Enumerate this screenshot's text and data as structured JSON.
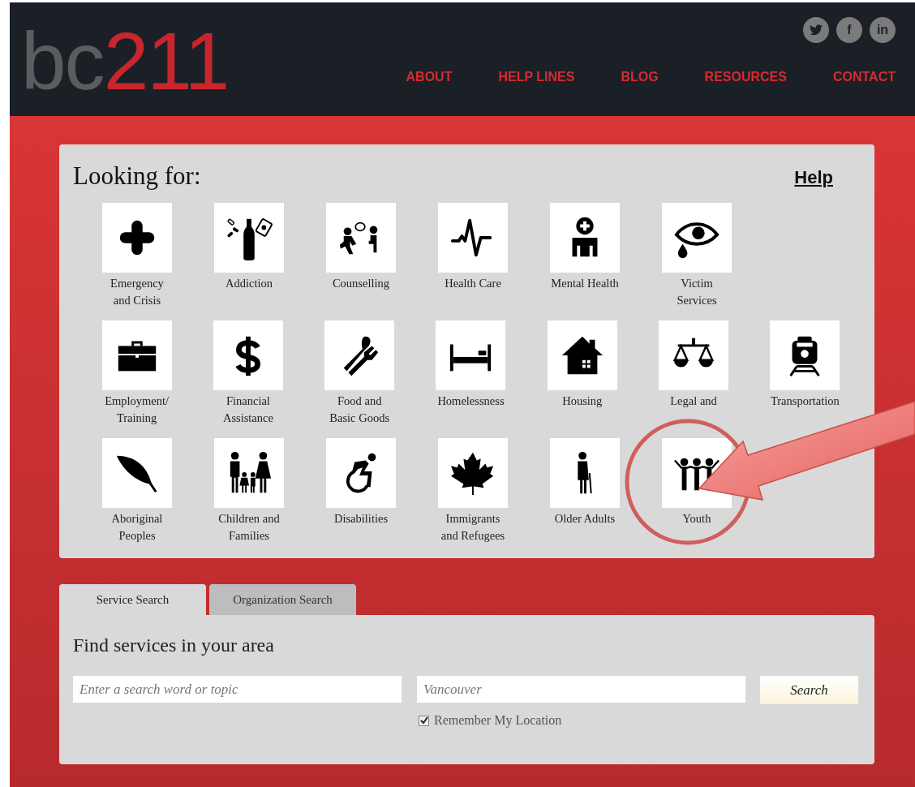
{
  "header": {
    "logo": {
      "prefix": "bc",
      "number": "211"
    },
    "social": [
      {
        "kind": "twitter"
      },
      {
        "kind": "text",
        "text": "f"
      },
      {
        "kind": "text",
        "text": "in"
      }
    ],
    "nav": [
      "ABOUT",
      "HELP LINES",
      "BLOG",
      "RESOURCES",
      "CONTACT"
    ]
  },
  "looking_for": {
    "title": "Looking for:",
    "help": "Help",
    "rows": [
      [
        {
          "label": "Emergency\nand Crisis"
        },
        {
          "label": "Addiction"
        },
        {
          "label": "Counselling"
        },
        {
          "label": "Health Care"
        },
        {
          "label": "Mental Health"
        },
        {
          "label": "Victim\nServices"
        }
      ],
      [
        {
          "label": "Employment/\nTraining"
        },
        {
          "label": "Financial\nAssistance"
        },
        {
          "label": "Food and\nBasic Goods"
        },
        {
          "label": "Homelessness"
        },
        {
          "label": "Housing"
        },
        {
          "label": "Legal and"
        },
        {
          "label": "Transportation"
        }
      ],
      [
        {
          "label": "Aboriginal\nPeoples"
        },
        {
          "label": "Children and\nFamilies"
        },
        {
          "label": "Disabilities"
        },
        {
          "label": "Immigrants\nand Refugees"
        },
        {
          "label": "Older Adults"
        },
        {
          "label": "Youth"
        }
      ]
    ]
  },
  "tabs": [
    {
      "label": "Service Search",
      "selected": true
    },
    {
      "label": "Organization Search",
      "selected": false
    }
  ],
  "search": {
    "title": "Find services in your area",
    "topic": {
      "placeholder": "Enter a search word or topic"
    },
    "location": {
      "placeholder": "Vancouver"
    },
    "button": "Search",
    "remember": {
      "label": "Remember My Location",
      "checked": true
    }
  }
}
